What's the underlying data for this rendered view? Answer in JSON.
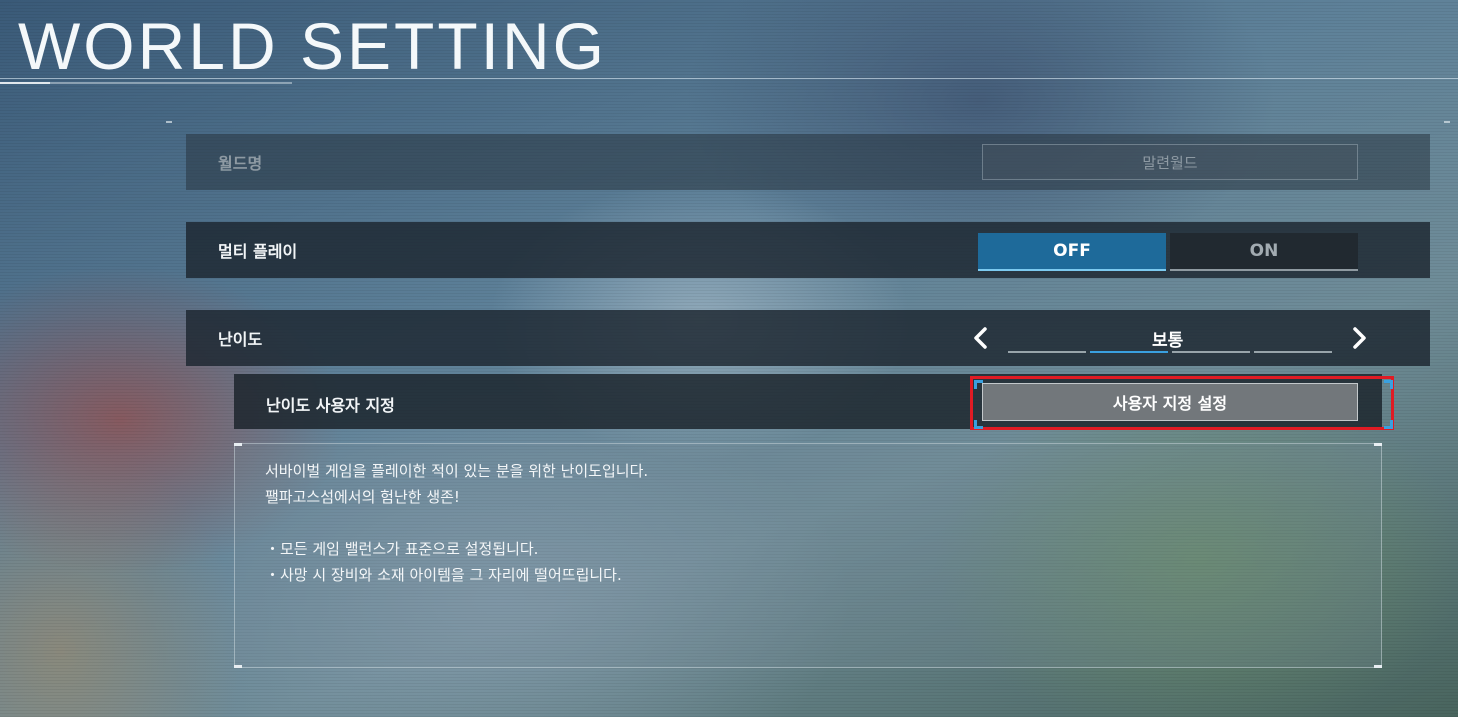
{
  "header": {
    "title": "WORLD SETTING"
  },
  "world_name": {
    "label": "월드명",
    "value": "말련월드"
  },
  "multiplayer": {
    "label": "멀티 플레이",
    "off_label": "OFF",
    "on_label": "ON",
    "selected": "OFF"
  },
  "difficulty": {
    "label": "난이도",
    "value": "보통",
    "level_count": 4,
    "selected_level": 2
  },
  "custom_difficulty": {
    "label": "난이도 사용자 지정",
    "button_label": "사용자 지정 설정"
  },
  "description": {
    "line1": "서바이벌 게임을 플레이한 적이 있는 분을 위한 난이도입니다.",
    "line2": "팰파고스섬에서의 험난한 생존!",
    "bullet1": "・모든 게임 밸런스가 표준으로 설정됩니다.",
    "bullet2": "・사망 시 장비와 소재 아이템을 그 자리에 떨어뜨립니다."
  },
  "colors": {
    "accent": "#1e6a9a",
    "highlight": "#e01b24",
    "segment_active": "#3aa0df"
  },
  "icons": {
    "prev": "chevron-left-icon",
    "next": "chevron-right-icon"
  }
}
